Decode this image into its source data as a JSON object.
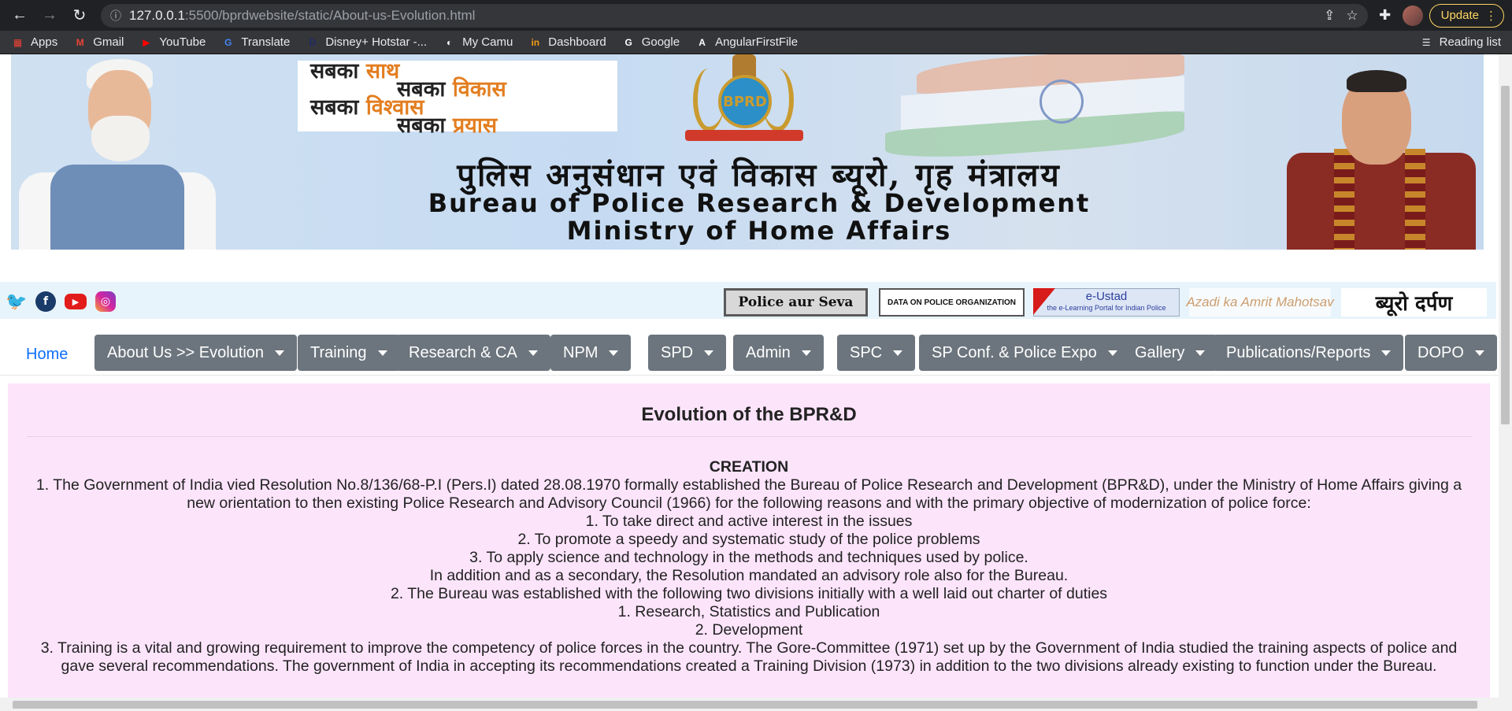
{
  "browser": {
    "url_host": "127.0.0.1",
    "url_path": ":5500/bprdwebsite/static/About-us-Evolution.html",
    "update_label": "Update",
    "bookmarks": [
      {
        "label": "Apps",
        "icon": "apps-grid-icon",
        "color": "#ea4335"
      },
      {
        "label": "Gmail",
        "icon": "gmail-icon",
        "color": "#ea4335"
      },
      {
        "label": "YouTube",
        "icon": "youtube-icon",
        "color": "#ff0000"
      },
      {
        "label": "Translate",
        "icon": "translate-icon",
        "color": "#4285f4"
      },
      {
        "label": "Disney+ Hotstar -...",
        "icon": "hotstar-icon",
        "color": "#1f2a6b"
      },
      {
        "label": "My Camu",
        "icon": "camu-icon",
        "color": "#ffffff"
      },
      {
        "label": "Dashboard",
        "icon": "dashboard-icon",
        "color": "#f39c12"
      },
      {
        "label": "Google",
        "icon": "google-icon",
        "color": "#ffffff"
      },
      {
        "label": "AngularFirstFile",
        "icon": "angular-icon",
        "color": "#ffffff"
      }
    ],
    "reading_list_label": "Reading list"
  },
  "banner": {
    "slogan": {
      "l1a": "सबका ",
      "l1b": "साथ",
      "l2a": "सबका ",
      "l2b": "विकास",
      "l3a": "सबका ",
      "l3b": "विश्वास",
      "l4a": "सबका ",
      "l4b": "प्रयास"
    },
    "emblem_text": "BPRD",
    "hindi_title": "पुलिस अनुसंधान एवं विकास ब्यूरो, गृह मंत्रालय",
    "eng_title_1": "Bureau of Police Research & Development",
    "eng_title_2": "Ministry of Home Affairs"
  },
  "strip": {
    "logo1": "Police aur Seva",
    "logo2": "DATA ON POLICE ORGANIZATION",
    "logo3_title": "e-Ustad",
    "logo3_sub": "the e-Learning Portal for Indian Police",
    "logo4": "Azadi ka Amrit Mahotsav",
    "logo5": "ब्यूरो दर्पण"
  },
  "nav": {
    "home": "Home",
    "items": [
      "About Us >> Evolution",
      "Training",
      "Research & CA",
      "NPM",
      "SPD",
      "Admin",
      "SPC",
      "SP Conf. & Police Expo",
      "Gallery",
      "Publications/Reports",
      "DOPO"
    ]
  },
  "content": {
    "title": "Evolution of the BPR&D",
    "creation": "CREATION",
    "lines": [
      "1. The Government of India vied Resolution No.8/136/68-P.I (Pers.I) dated 28.08.1970 formally established the Bureau of Police Research and Development (BPR&D), under the Ministry of Home Affairs giving a new orientation to then existing Police Research and Advisory Council (1966) for the following reasons and with the primary objective of modernization of police force:",
      "1. To take direct and active interest in the issues",
      "2. To promote a speedy and systematic study of the police problems",
      "3. To apply science and technology in the methods and techniques used by police.",
      "In addition and as a secondary, the Resolution mandated an advisory role also for the Bureau.",
      "2. The Bureau was established with the following two divisions initially with a well laid out charter of duties",
      "1. Research, Statistics and Publication",
      "2. Development",
      "3. Training is a vital and growing requirement to improve the competency of police forces in the country. The Gore-Committee (1971) set up by the Government of India studied the training aspects of police and gave several recommendations. The government of India in accepting its recommendations created a Training Division (1973) in addition to the two divisions already existing to function under the Bureau."
    ]
  }
}
